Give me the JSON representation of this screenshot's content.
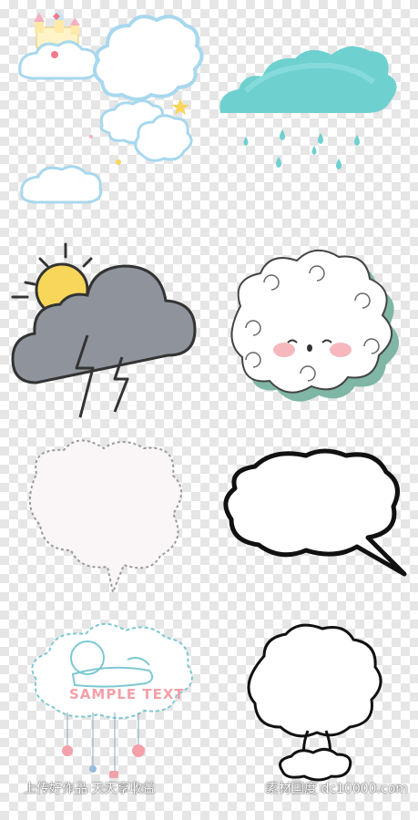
{
  "sticker_sheet": {
    "sample_text": "SAMPLE TEXT",
    "watermark_left": "上传好作品 天天享收益",
    "watermark_right": "素材国度 dc10000.com"
  },
  "colors": {
    "cloud_blue_outline": "#a8d8ee",
    "rain_teal": "#6fd0d0",
    "storm_gray": "#8f949c",
    "sun_yellow": "#f7d65a",
    "blush_pink": "#f4a6ad",
    "shadow_green": "#7fb6a6",
    "dotted_border": "#888888",
    "sample_pink": "#f4a0a8"
  },
  "icons": [
    "castle-cloud-icon",
    "rain-cloud-icon",
    "storm-sun-cloud-icon",
    "cute-face-cloud-icon",
    "dotted-speech-cloud-icon",
    "speech-bubble-icon",
    "baby-sleeping-cloud-icon",
    "mushroom-cloud-icon"
  ]
}
